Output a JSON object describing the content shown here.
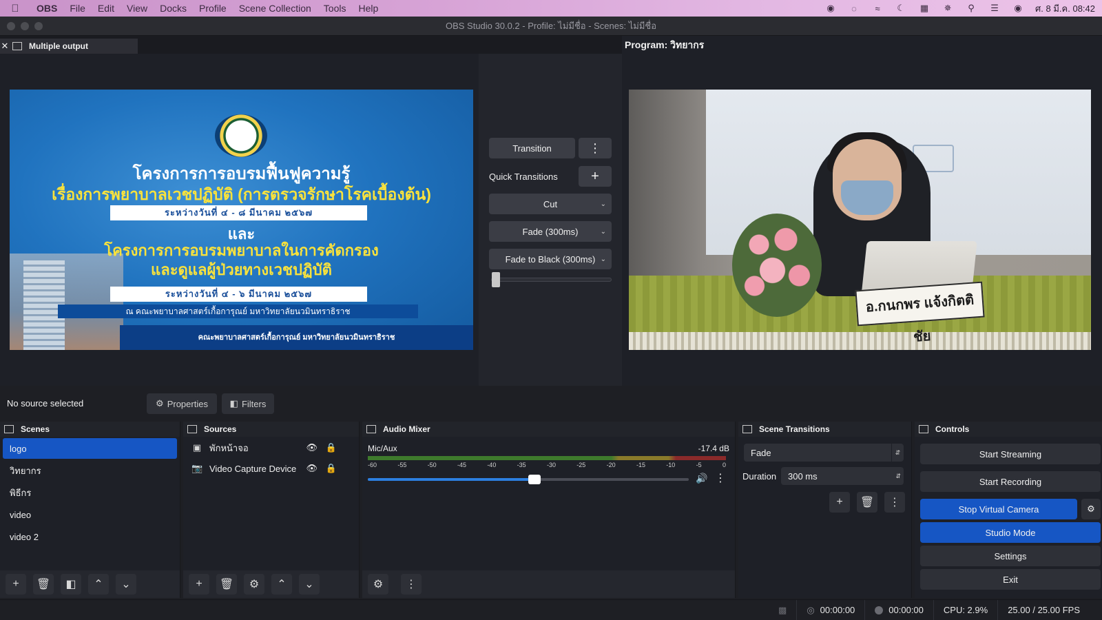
{
  "menubar": {
    "apple": "",
    "app": "OBS",
    "items": [
      "File",
      "Edit",
      "View",
      "Docks",
      "Profile",
      "Scene Collection",
      "Tools",
      "Help"
    ],
    "datetime": "ศ. 8 มี.ค.  08:42"
  },
  "window": {
    "title": "OBS Studio 30.0.2 - Profile: ไม่มีชื่อ - Scenes: ไม่มีชื่อ"
  },
  "preview": {
    "tab_label": "Multiple output",
    "program_label": "Program: วิทยากร",
    "banner": {
      "line1": "โครงการการอบรมฟื้นฟูความรู้",
      "line2": "เรื่องการพยาบาลเวชปฏิบัติ (การตรวจรักษาโรคเบื้องต้น)",
      "date1": "ระหว่างวันที่ ๔ - ๘ มีนาคม ๒๕๖๗",
      "and": "และ",
      "line3": "โครงการการอบรมพยาบาลในการคัดกรอง",
      "line4": "และดูแลผู้ป่วยทางเวชปฏิบัติ",
      "date2": "ระหว่างวันที่ ๔ - ๖ มีนาคม ๒๕๖๗",
      "faculty": "ณ คณะพยาบาลศาสตร์เกื้อการุณย์ มหาวิทยาลัยนวมินทราธิราช",
      "footer": "คณะพยาบาลศาสตร์เกื้อการุณย์ มหาวิทยาลัยนวมินทราธิราช"
    },
    "nameplate": "อ.กนกพร แจ้งกิตติชัย"
  },
  "transitions_panel": {
    "transition_button": "Transition",
    "quick_transitions_label": "Quick Transitions",
    "items": [
      "Cut",
      "Fade (300ms)",
      "Fade to Black (300ms)"
    ],
    "tbar_value": 0
  },
  "context": {
    "no_source": "No source selected",
    "properties": "Properties",
    "filters": "Filters"
  },
  "docks": {
    "scenes": {
      "title": "Scenes",
      "items": [
        "logo",
        "วิทยากร",
        "พิธีกร",
        "video",
        "video 2"
      ],
      "selected": "logo"
    },
    "sources": {
      "title": "Sources",
      "items": [
        {
          "label": "พักหน้าจอ",
          "icon": "image-icon"
        },
        {
          "label": "Video Capture Device",
          "icon": "camera-icon"
        }
      ]
    },
    "audio_mixer": {
      "title": "Audio Mixer",
      "channel": "Mic/Aux",
      "level": "-17.4 dB",
      "ticks": [
        "-60",
        "-55",
        "-50",
        "-45",
        "-40",
        "-35",
        "-30",
        "-25",
        "-20",
        "-15",
        "-10",
        "-5",
        "0"
      ],
      "volume_fraction": 0.52
    },
    "scene_transitions": {
      "title": "Scene Transitions",
      "selected": "Fade",
      "duration_label": "Duration",
      "duration_value": "300 ms"
    },
    "controls": {
      "title": "Controls",
      "start_streaming": "Start Streaming",
      "start_recording": "Start Recording",
      "stop_virtual_camera": "Stop Virtual Camera",
      "studio_mode": "Studio Mode",
      "settings": "Settings",
      "exit": "Exit"
    }
  },
  "statusbar": {
    "stream_time": "00:00:00",
    "record_time": "00:00:00",
    "cpu": "CPU: 2.9%",
    "fps": "25.00 / 25.00 FPS"
  },
  "colors": {
    "accent_blue": "#1656c4",
    "background": "#1e2027"
  }
}
